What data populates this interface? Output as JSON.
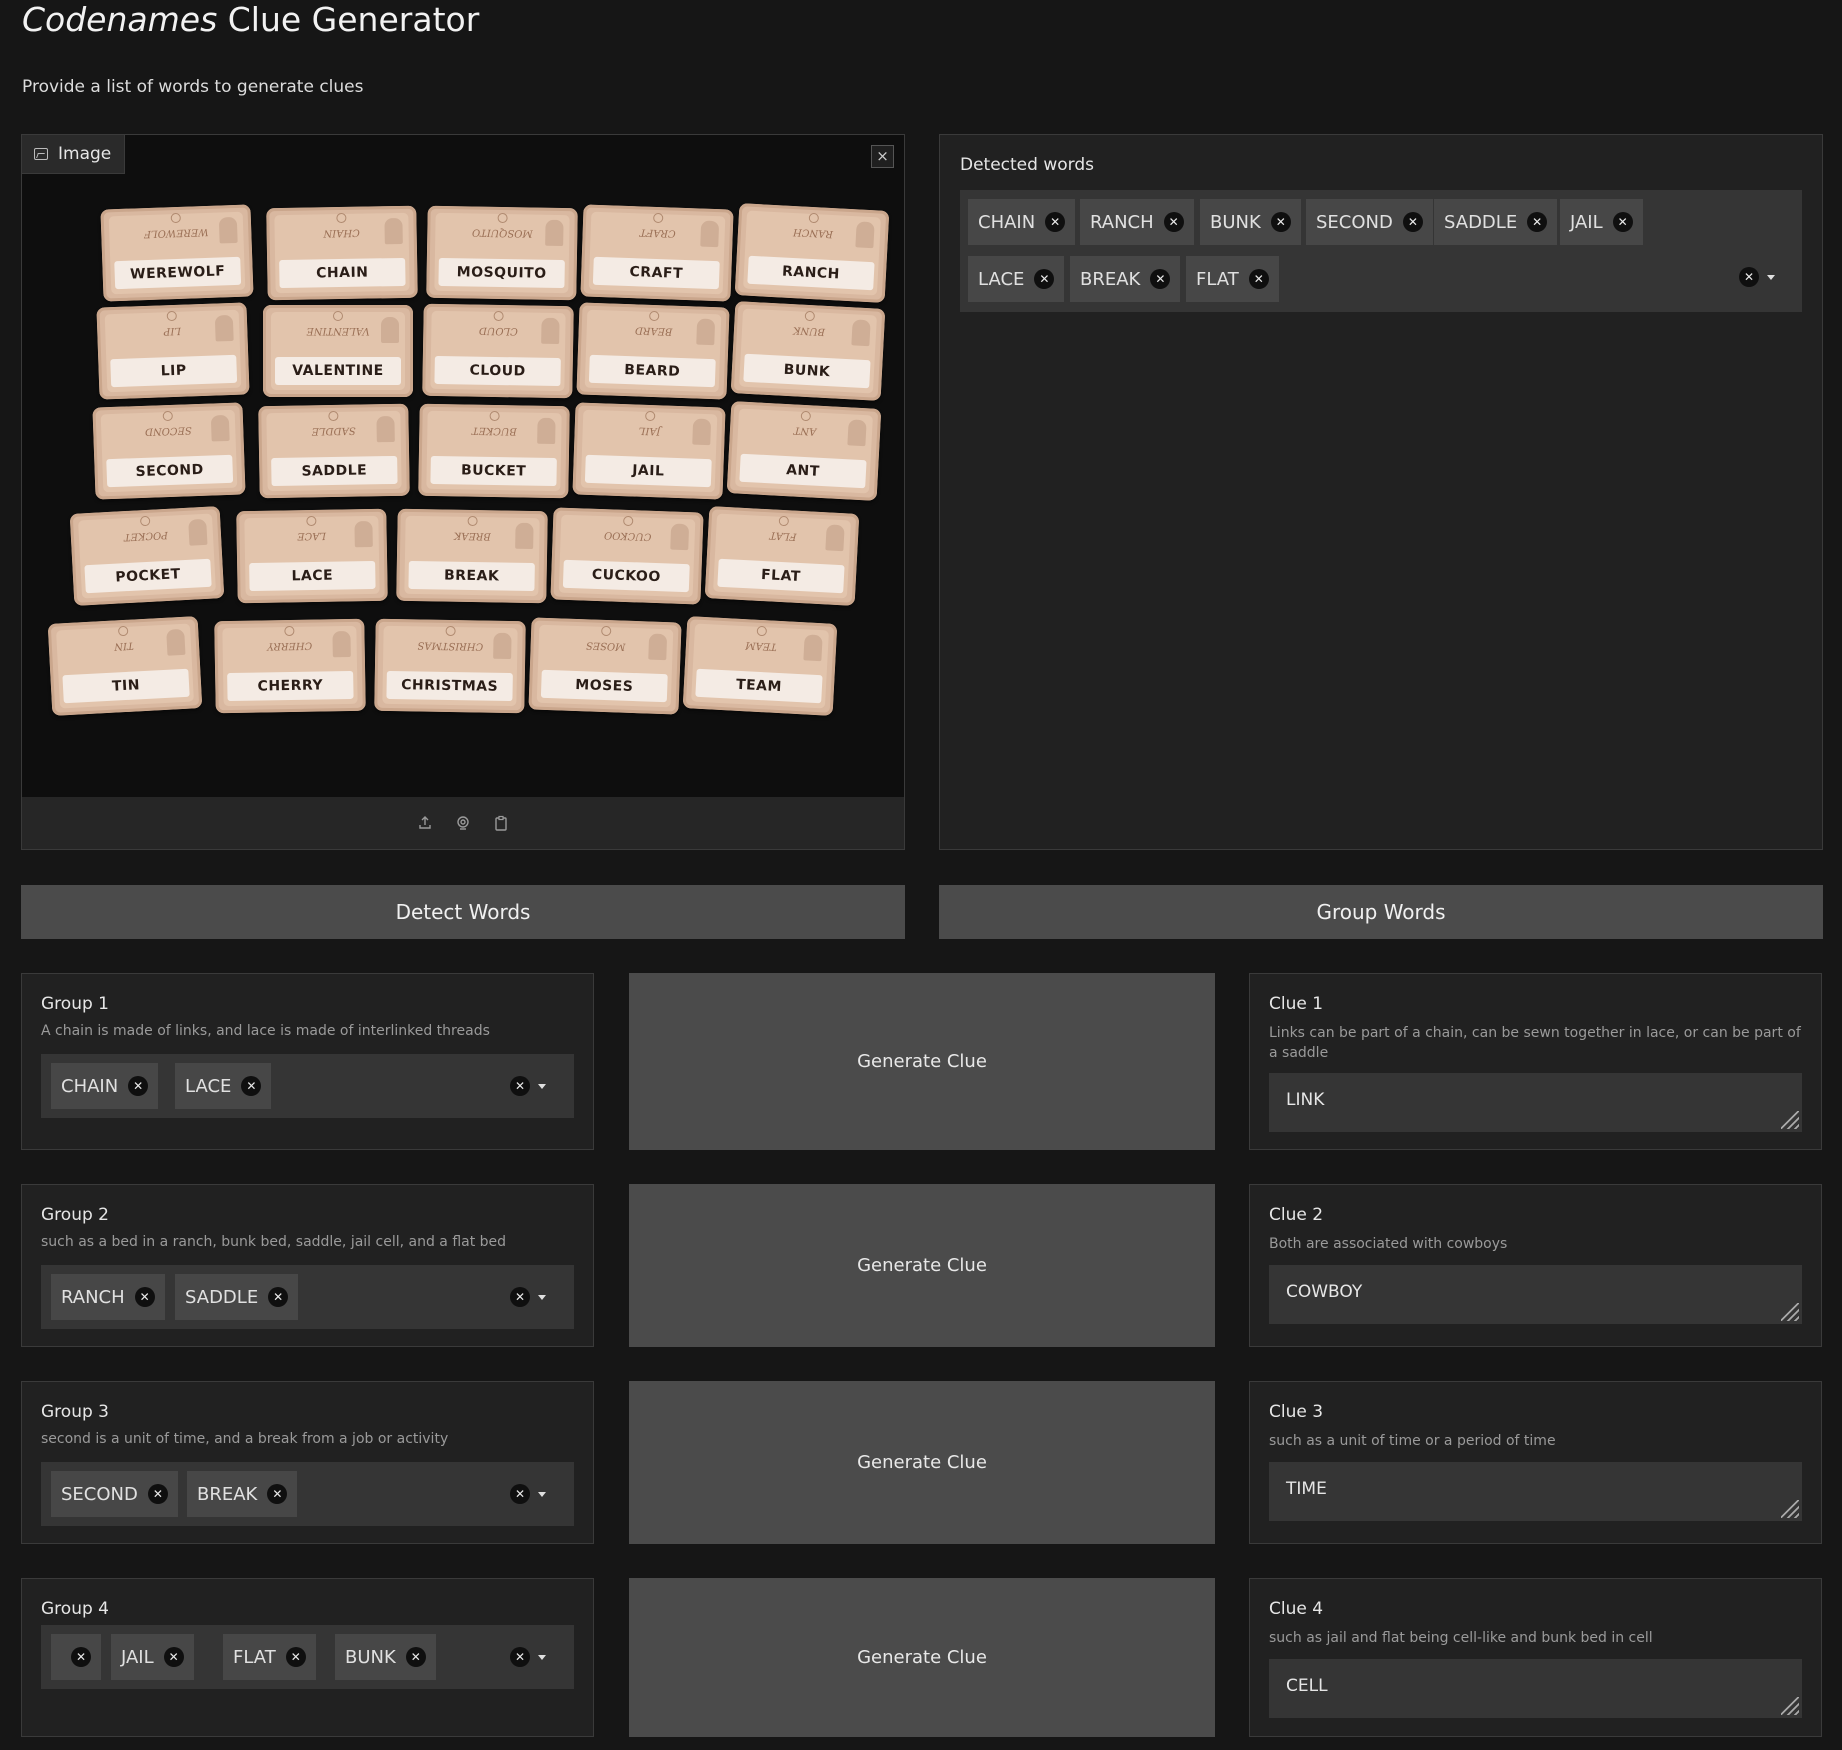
{
  "header": {
    "title_italic": "Codenames",
    "title_rest": "Clue Generator",
    "description": "Provide a list of words to generate clues"
  },
  "image_panel": {
    "label": "Image",
    "close": "×",
    "toolbar": [
      "upload-icon",
      "webcam-icon",
      "clipboard-icon"
    ],
    "cards": [
      [
        "WEREWOLF",
        "CHAIN",
        "MOSQUITO",
        "CRAFT",
        "RANCH"
      ],
      [
        "LIP",
        "VALENTINE",
        "CLOUD",
        "BEARD",
        "BUNK"
      ],
      [
        "SECOND",
        "SADDLE",
        "BUCKET",
        "JAIL",
        "ANT"
      ],
      [
        "POCKET",
        "LACE",
        "BREAK",
        "CUCKOO",
        "FLAT"
      ],
      [
        "TIN",
        "CHERRY",
        "CHRISTMAS",
        "MOSES",
        "TEAM"
      ]
    ]
  },
  "detected": {
    "label": "Detected words",
    "chips": [
      "CHAIN",
      "RANCH",
      "BUNK",
      "SECOND",
      "SADDLE",
      "JAIL",
      "LACE",
      "BREAK",
      "FLAT"
    ]
  },
  "buttons": {
    "detect": "Detect Words",
    "group": "Group Words",
    "generate": "Generate Clue"
  },
  "groups": [
    {
      "title": "Group 1",
      "desc": "A chain is made of links, and lace is made of interlinked threads",
      "chips": [
        "CHAIN",
        "LACE"
      ]
    },
    {
      "title": "Group 2",
      "desc": "such as a bed in a ranch, bunk bed, saddle, jail cell, and a flat bed",
      "chips": [
        "RANCH",
        "SADDLE"
      ]
    },
    {
      "title": "Group 3",
      "desc": "second is a unit of time, and a break from a job or activity",
      "chips": [
        "SECOND",
        "BREAK"
      ]
    },
    {
      "title": "Group 4",
      "desc": "",
      "chips": [
        "",
        "JAIL",
        "FLAT",
        "BUNK"
      ]
    }
  ],
  "clues": [
    {
      "title": "Clue 1",
      "desc": "Links can be part of a chain, can be sewn together in lace, or can be part of a saddle",
      "value": "LINK"
    },
    {
      "title": "Clue 2",
      "desc": "Both are associated with cowboys",
      "value": "COWBOY"
    },
    {
      "title": "Clue 3",
      "desc": "such as a unit of time or a period of time",
      "value": "TIME"
    },
    {
      "title": "Clue 4",
      "desc": "such as jail and flat being cell-like and bunk bed in cell",
      "value": "CELL"
    }
  ]
}
